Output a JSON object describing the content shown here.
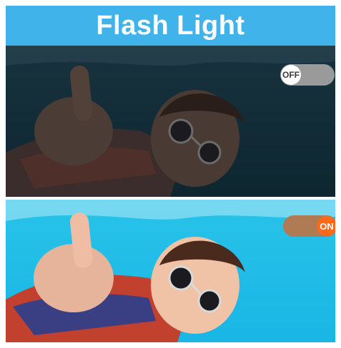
{
  "header": {
    "title": "Flash Light"
  },
  "panels": {
    "off": {
      "toggle_label": "OFF"
    },
    "on": {
      "toggle_label": "ON"
    }
  },
  "colors": {
    "header_bg": "#3fb3ea",
    "toggle_on_knob": "#ff6a1a",
    "toggle_off_track": "#9a9a9a"
  }
}
